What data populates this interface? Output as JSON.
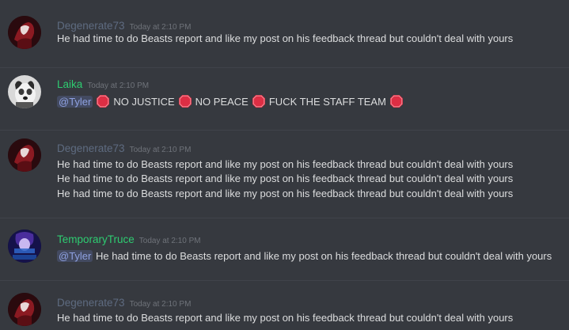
{
  "colors": {
    "background": "#36393f",
    "degenerate_name": "#5e6b80",
    "laika_name": "#2ecc71",
    "temporary_name": "#2ecc71",
    "mention_text": "#8ea1e1",
    "stop_sign": "#dd2e44"
  },
  "messages": [
    {
      "username": "Degenerate73",
      "timestamp": "Today at 2:10 PM",
      "avatar_icon": "dark-red-figure-avatar",
      "lines": [
        "He had time to do Beasts report and like my post on his feedback thread but couldn't deal with yours"
      ]
    },
    {
      "username": "Laika",
      "timestamp": "Today at 2:10 PM",
      "avatar_icon": "dog-avatar",
      "mention": "@Tyler",
      "segments": [
        "NO JUSTICE",
        "NO PEACE",
        "FUCK THE STAFF TEAM"
      ],
      "emoji_icon": "octagonal-sign-icon"
    },
    {
      "username": "Degenerate73",
      "timestamp": "Today at 2:10 PM",
      "avatar_icon": "dark-red-figure-avatar",
      "lines": [
        "He had time to do Beasts report and like my post on his feedback thread but couldn't deal with yours",
        "He had time to do Beasts report and like my post on his feedback thread but couldn't deal with yours",
        "He had time to do Beasts report and like my post on his feedback thread but couldn't deal with yours"
      ]
    },
    {
      "username": "TemporaryTruce",
      "timestamp": "Today at 2:10 PM",
      "avatar_icon": "purple-character-avatar",
      "mention": "@Tyler",
      "text": " He had time to do Beasts report and like my post on his feedback thread but couldn't deal with yours"
    },
    {
      "username": "Degenerate73",
      "timestamp": "Today at 2:10 PM",
      "avatar_icon": "dark-red-figure-avatar",
      "lines": [
        "He had time to do Beasts report and like my post on his feedback thread but couldn't deal with yours"
      ]
    }
  ]
}
